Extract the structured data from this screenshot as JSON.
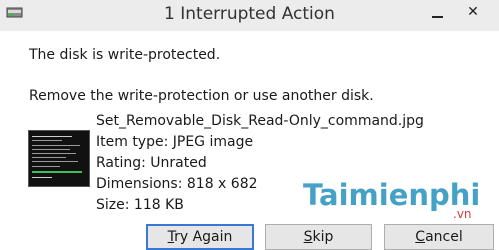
{
  "window": {
    "title": "1 Interrupted Action",
    "close_glyph": "✕"
  },
  "message": {
    "line1": "The disk is write-protected.",
    "line2": "Remove the write-protection or use another disk."
  },
  "file": {
    "name": "Set_Removable_Disk_Read-Only_command.jpg",
    "type": "Item type: JPEG image",
    "rating": "Rating: Unrated",
    "dimensions": "Dimensions: 818 x 682",
    "size": "Size: 118 KB"
  },
  "watermark": {
    "brand": "Taimienphi",
    "domain": ".vn"
  },
  "buttons": {
    "try_again": {
      "mnemonic": "T",
      "rest": "ry Again"
    },
    "skip": {
      "mnemonic": "S",
      "rest": "kip"
    },
    "cancel": {
      "mnemonic": "C",
      "rest": "ancel"
    }
  },
  "colors": {
    "title_bar": "#ececec",
    "default_button_border": "#3a76d3",
    "watermark_blue": "#45a2c6",
    "watermark_red": "#d04040"
  },
  "icons": [
    "drive-icon",
    "minimize-icon",
    "close-icon"
  ]
}
